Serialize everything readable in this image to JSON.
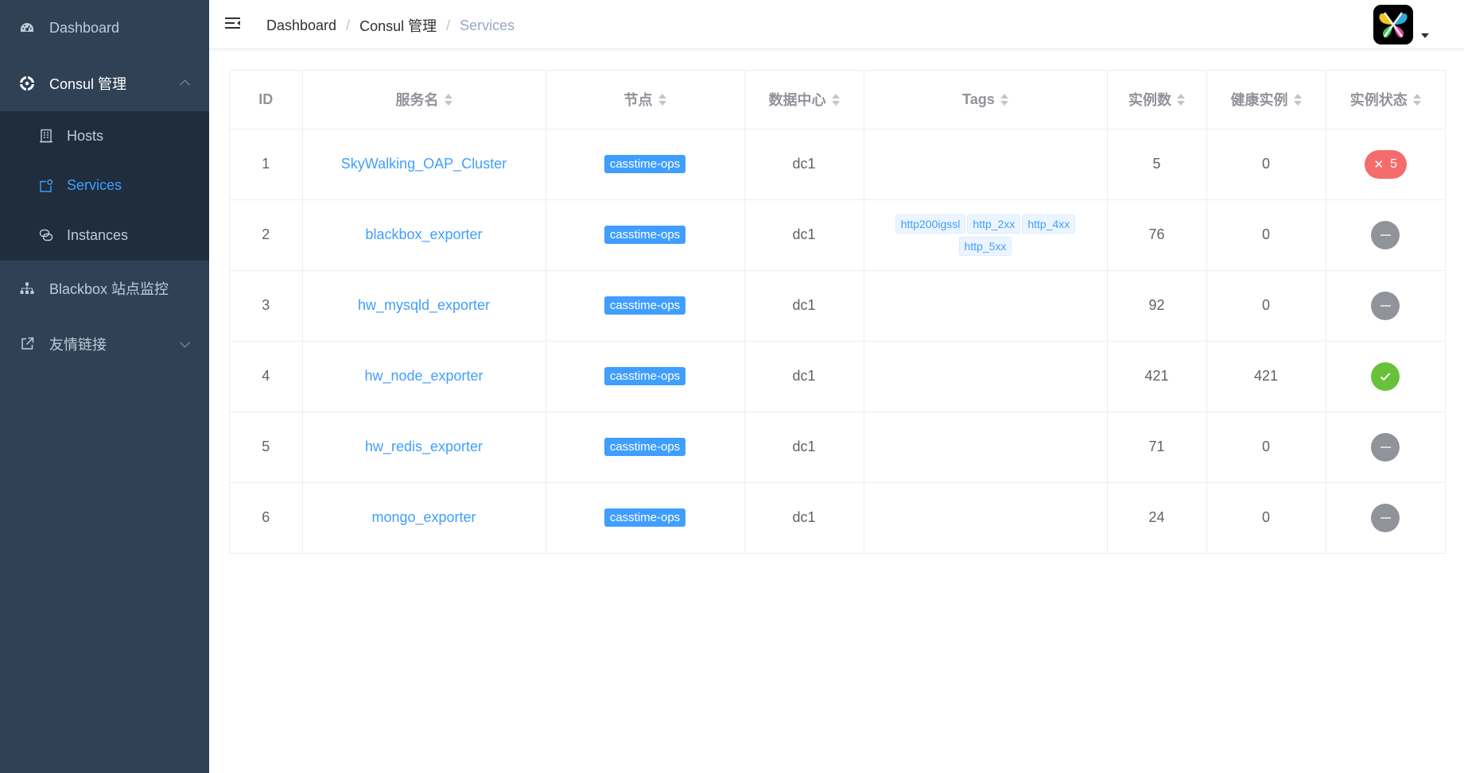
{
  "sidebar": {
    "items": [
      {
        "label": "Dashboard",
        "icon": "dashboard-icon"
      },
      {
        "label": "Consul 管理",
        "icon": "consul-icon",
        "expanded": true,
        "children": [
          {
            "label": "Hosts",
            "icon": "building-icon"
          },
          {
            "label": "Services",
            "icon": "service-icon",
            "active": true
          },
          {
            "label": "Instances",
            "icon": "instances-icon"
          }
        ]
      },
      {
        "label": "Blackbox 站点监控",
        "icon": "sitemap-icon"
      },
      {
        "label": "友情链接",
        "icon": "external-link-icon"
      }
    ]
  },
  "breadcrumb": [
    "Dashboard",
    "Consul 管理",
    "Services"
  ],
  "table": {
    "headers": [
      "ID",
      "服务名",
      "节点",
      "数据中心",
      "Tags",
      "实例数",
      "健康实例",
      "实例状态"
    ],
    "rows": [
      {
        "id": "1",
        "name": "SkyWalking_OAP_Cluster",
        "node": "casstime-ops",
        "dc": "dc1",
        "tags": [],
        "instances": "5",
        "healthy": "0",
        "status": "error",
        "status_text": "5"
      },
      {
        "id": "2",
        "name": "blackbox_exporter",
        "node": "casstime-ops",
        "dc": "dc1",
        "tags": [
          "http200igssl",
          "http_2xx",
          "http_4xx",
          "http_5xx"
        ],
        "instances": "76",
        "healthy": "0",
        "status": "none",
        "status_text": ""
      },
      {
        "id": "3",
        "name": "hw_mysqld_exporter",
        "node": "casstime-ops",
        "dc": "dc1",
        "tags": [],
        "instances": "92",
        "healthy": "0",
        "status": "none",
        "status_text": ""
      },
      {
        "id": "4",
        "name": "hw_node_exporter",
        "node": "casstime-ops",
        "dc": "dc1",
        "tags": [],
        "instances": "421",
        "healthy": "421",
        "status": "ok",
        "status_text": ""
      },
      {
        "id": "5",
        "name": "hw_redis_exporter",
        "node": "casstime-ops",
        "dc": "dc1",
        "tags": [],
        "instances": "71",
        "healthy": "0",
        "status": "none",
        "status_text": ""
      },
      {
        "id": "6",
        "name": "mongo_exporter",
        "node": "casstime-ops",
        "dc": "dc1",
        "tags": [],
        "instances": "24",
        "healthy": "0",
        "status": "none",
        "status_text": ""
      }
    ]
  },
  "colors": {
    "sidebar_bg": "#304156",
    "submenu_bg": "#1f2d3d",
    "active": "#409eff",
    "error": "#f56c6c",
    "success": "#67c23a",
    "neutral": "#909399"
  }
}
